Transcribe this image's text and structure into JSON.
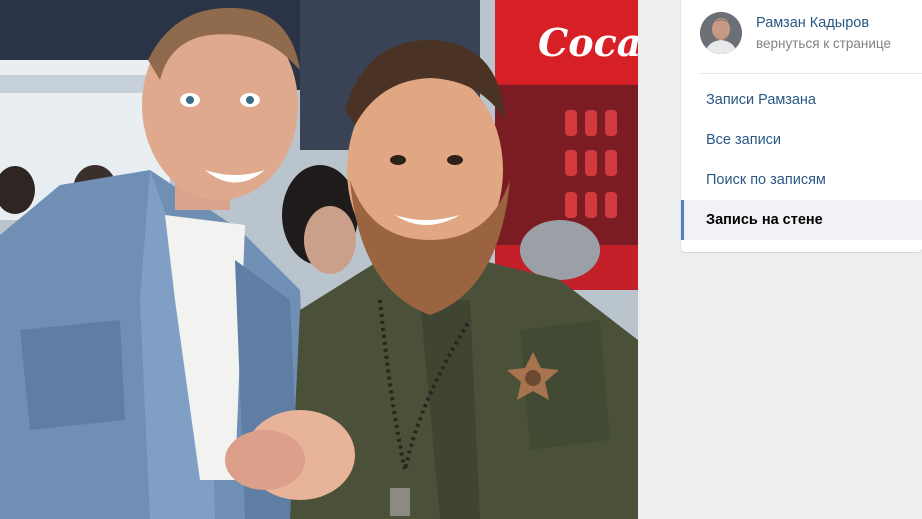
{
  "owner": {
    "name": "Рамзан Кадыров",
    "back_link": "вернуться к странице"
  },
  "menu": {
    "items": [
      {
        "label": "Записи Рамзана",
        "active": false
      },
      {
        "label": "Все записи",
        "active": false
      },
      {
        "label": "Поиск по записям",
        "active": false
      },
      {
        "label": "Запись на стене",
        "active": true
      }
    ]
  },
  "photo": {
    "sign_text": "Coca"
  },
  "colors": {
    "link": "#2a5885",
    "active_marker": "#5181b8",
    "page_bg": "#edeef0"
  }
}
